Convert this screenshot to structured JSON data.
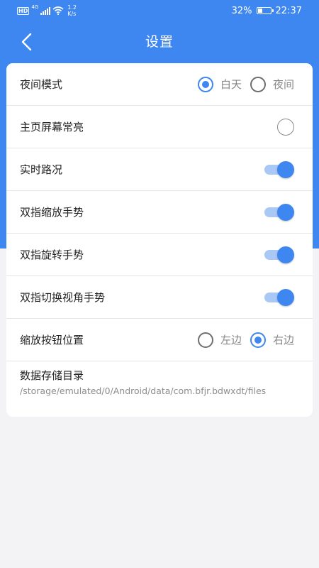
{
  "status_bar": {
    "hd": "HD",
    "network": "4G",
    "speed_value": "1.2",
    "speed_unit": "K/s",
    "battery": "32%",
    "time": "22:37"
  },
  "header": {
    "title": "设置"
  },
  "settings": {
    "night_mode": {
      "label": "夜间模式",
      "options": [
        "白天",
        "夜间"
      ],
      "selected": "白天"
    },
    "screen_always_on": {
      "label": "主页屏幕常亮",
      "checked": false
    },
    "realtime_traffic": {
      "label": "实时路况",
      "enabled": true
    },
    "pinch_zoom": {
      "label": "双指缩放手势",
      "enabled": true
    },
    "two_finger_rotate": {
      "label": "双指旋转手势",
      "enabled": true
    },
    "two_finger_tilt": {
      "label": "双指切换视角手势",
      "enabled": true
    },
    "zoom_button_position": {
      "label": "缩放按钮位置",
      "options": [
        "左边",
        "右边"
      ],
      "selected": "右边"
    },
    "data_directory": {
      "label": "数据存储目录",
      "path": "/storage/emulated/0/Android/data/com.bfjr.bdwxdt/files"
    }
  },
  "colors": {
    "accent": "#3e86f0",
    "toggle_track": "#a9c8f6",
    "background": "#f3f3f5"
  }
}
